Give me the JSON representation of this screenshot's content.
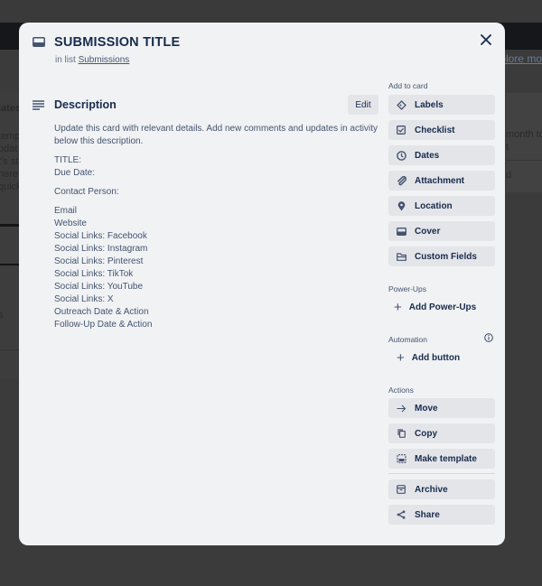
{
  "background": {
    "explore_link": "Explore mo",
    "left_fragments": [
      "lates",
      "temp",
      "pdat",
      "t's st",
      "here i",
      "quick",
      "s"
    ],
    "right_fragments": [
      "month to",
      "t",
      "d"
    ]
  },
  "card": {
    "title": "SUBMISSION TITLE",
    "in_list_prefix": "in list",
    "list_name": "Submissions",
    "close_icon": "close-icon",
    "card_icon": "card-icon"
  },
  "description": {
    "heading": "Description",
    "edit_label": "Edit",
    "intro": "Update this card with relevant details. Add new comments and updates in activity below this description.",
    "block1": [
      "TITLE:",
      "Due Date:"
    ],
    "block2": [
      "Contact Person:"
    ],
    "block3": [
      "Email",
      "Website",
      "Social Links: Facebook",
      "Social Links: Instagram",
      "Social Links: Pinterest",
      "Social Links: TikTok",
      "Social Links: YouTube",
      "Social Links: X",
      "Outreach Date & Action",
      "Follow-Up Date & Action"
    ]
  },
  "sidebar": {
    "add_to_card": {
      "label": "Add to card",
      "items": [
        {
          "label": "Labels",
          "icon": "label-icon"
        },
        {
          "label": "Checklist",
          "icon": "checklist-icon"
        },
        {
          "label": "Dates",
          "icon": "clock-icon"
        },
        {
          "label": "Attachment",
          "icon": "paperclip-icon"
        },
        {
          "label": "Location",
          "icon": "location-pin-icon"
        },
        {
          "label": "Cover",
          "icon": "cover-icon"
        },
        {
          "label": "Custom Fields",
          "icon": "custom-fields-icon"
        }
      ]
    },
    "power_ups": {
      "label": "Power-Ups",
      "add_label": "Add Power-Ups"
    },
    "automation": {
      "label": "Automation",
      "add_label": "Add button"
    },
    "actions": {
      "label": "Actions",
      "items": [
        {
          "label": "Move",
          "icon": "arrow-right-icon"
        },
        {
          "label": "Copy",
          "icon": "copy-icon"
        },
        {
          "label": "Make template",
          "icon": "template-icon"
        },
        {
          "label": "Archive",
          "icon": "archive-icon"
        },
        {
          "label": "Share",
          "icon": "share-icon"
        }
      ]
    }
  }
}
